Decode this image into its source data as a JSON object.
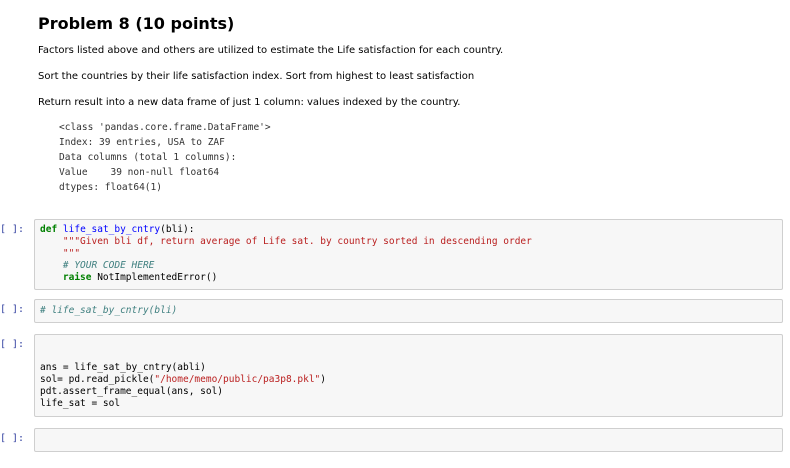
{
  "markdown": {
    "title": "Problem 8 (10 points)",
    "p1": "Factors listed above and others are utilized to estimate the Life satisfaction for each country.",
    "p2": "Sort the countries by their life satisfaction index. Sort from highest to least satisfaction",
    "p3": "Return result into a new data frame of just 1 column: values indexed by the country.",
    "info_lines": [
      "<class 'pandas.core.frame.DataFrame'>",
      "Index: 39 entries, USA to ZAF",
      "Data columns (total 1 columns):",
      "Value    39 non-null float64",
      "dtypes: float64(1)"
    ]
  },
  "cells": [
    {
      "prompt": "[ ]:",
      "def_kw": "def",
      "func_name": "life_sat_by_cntry",
      "params": "(bli):",
      "docstring_1": "    \"\"\"Given bli df, return average of Life sat. by country sorted in descending order",
      "docstring_2": "    \"\"\"",
      "comment": "    # YOUR CODE HERE",
      "raise_kw": "    raise",
      "raise_rest": " NotImplementedError()"
    },
    {
      "prompt": "[ ]:",
      "comment": "# life_sat_by_cntry(bli)"
    },
    {
      "prompt": "[ ]:",
      "lines": [
        "ans = life_sat_by_cntry(abli)",
        "sol= pd.read_pickle(",
        "pdt.assert_frame_equal(ans, sol)",
        "life_sat = sol"
      ],
      "path_str": "\"/home/memo/public/pa3p8.pkl\"",
      "close_paren": ")"
    },
    {
      "prompt": "[ ]:"
    }
  ]
}
